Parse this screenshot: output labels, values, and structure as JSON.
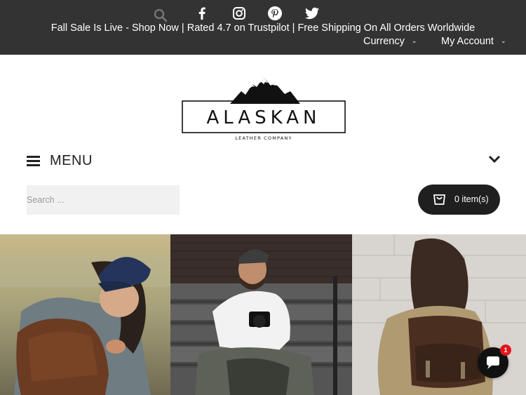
{
  "topbar": {
    "social": [
      {
        "name": "facebook-icon"
      },
      {
        "name": "instagram-icon"
      },
      {
        "name": "pinterest-icon"
      },
      {
        "name": "twitter-icon"
      }
    ],
    "promo": "Fall Sale Is Live - Shop Now | Rated 4.7 on Trustpilot | Free Shipping On All Orders Worldwide",
    "currency_label": "Currency",
    "account_label": "My Account",
    "background_color": "#333333"
  },
  "logo": {
    "brand": "ALASKAN",
    "tagline": "LEATHER COMPANY"
  },
  "menu": {
    "label": "MENU"
  },
  "search": {
    "placeholder": "Search ..."
  },
  "cart": {
    "label": "0 item(s)",
    "background_color": "#1f1f1f"
  },
  "hero": {
    "panels": [
      {
        "name": "hero-image-woman-blue-cap-leather-bag"
      },
      {
        "name": "hero-image-man-camera-stairs"
      },
      {
        "name": "hero-image-woman-leather-backpack"
      }
    ]
  },
  "chat": {
    "badge_count": "1"
  }
}
